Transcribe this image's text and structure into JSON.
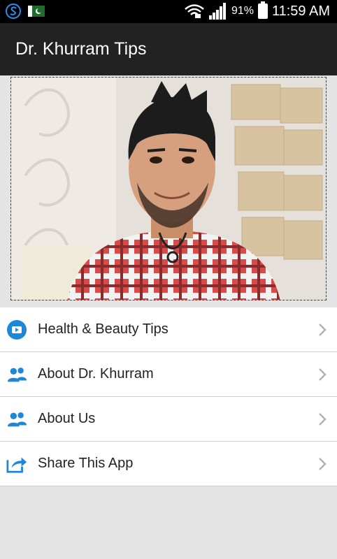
{
  "status": {
    "icons": [
      "swype-icon",
      "pakistan-flag-icon",
      "wifi-icon",
      "signal-icon",
      "battery-icon"
    ],
    "battery": "91%",
    "time": "11:59 AM"
  },
  "appbar": {
    "title": "Dr. Khurram Tips"
  },
  "menu": {
    "items": [
      {
        "label": "Health & Beauty Tips",
        "icon": "youtube-play-icon"
      },
      {
        "label": "About Dr. Khurram",
        "icon": "people-icon"
      },
      {
        "label": "About Us",
        "icon": "people-icon"
      },
      {
        "label": "Share This App",
        "icon": "share-icon"
      }
    ]
  },
  "colors": {
    "accent": "#1e88d6",
    "appbar": "#222222",
    "statusbar": "#000000"
  }
}
